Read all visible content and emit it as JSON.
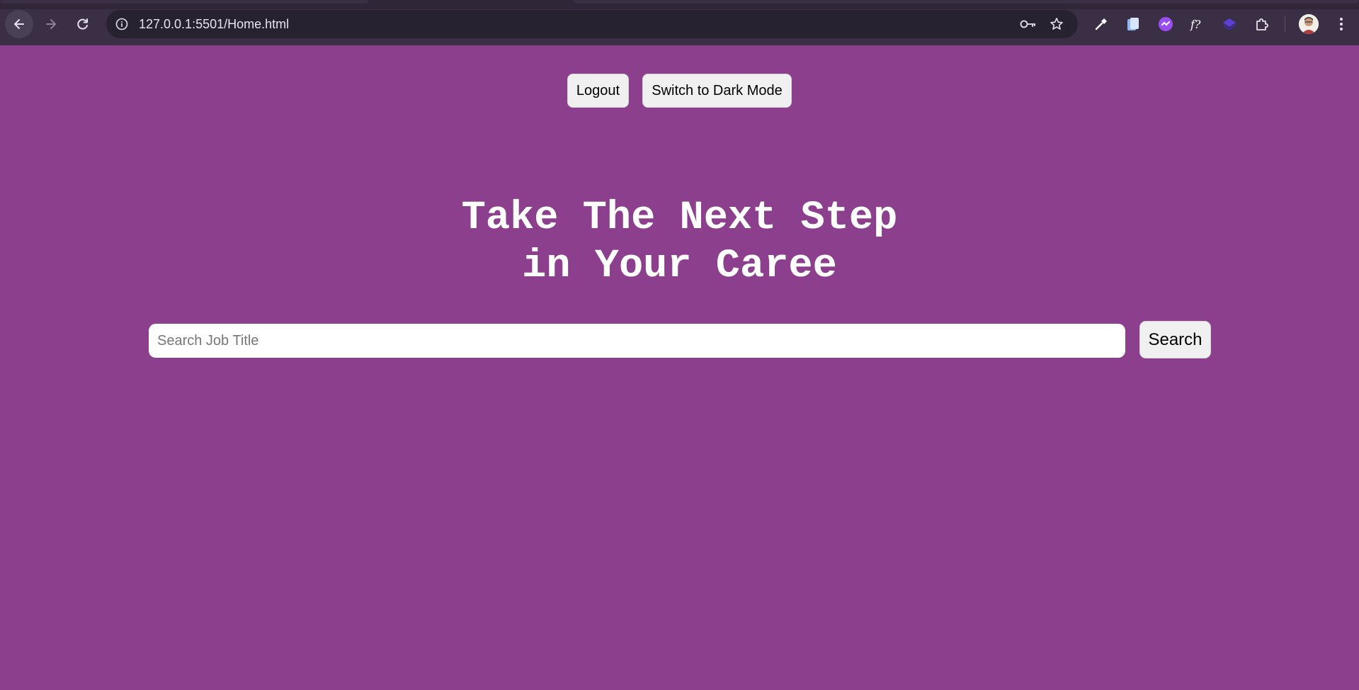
{
  "browser": {
    "url": "127.0.0.1:5501/Home.html"
  },
  "header": {
    "logout_label": "Logout",
    "dark_mode_label": "Switch to Dark Mode"
  },
  "hero": {
    "title_line1": "Take The Next Step",
    "title_line2": "in Your Caree"
  },
  "search": {
    "placeholder": "Search Job Title",
    "value": "",
    "button_label": "Search"
  },
  "colors": {
    "page_background": "#8c3f8c",
    "chrome_background": "#3a2f45",
    "button_background": "#f0f0f0",
    "title_color": "#ffffff"
  },
  "icons": {
    "toolbar": [
      "back-arrow-icon",
      "forward-arrow-icon",
      "reload-icon",
      "site-info-icon",
      "password-key-icon",
      "bookmark-star-icon"
    ],
    "extensions": [
      "eyedropper-extension-icon",
      "clipboard-extension-icon",
      "purple-extension-icon",
      "font-extension-icon",
      "layers-extension-icon",
      "puzzle-extensions-icon"
    ],
    "profile": "profile-avatar",
    "menu": "more-vert-icon"
  }
}
